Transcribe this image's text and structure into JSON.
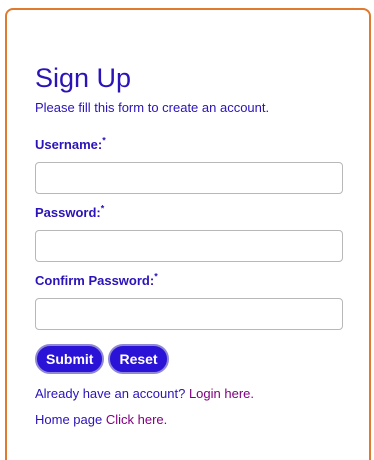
{
  "form": {
    "title": "Sign Up",
    "subtitle": "Please fill this form to create an account.",
    "required_marker": "*",
    "fields": [
      {
        "label": "Username:",
        "value": "",
        "placeholder": ""
      },
      {
        "label": "Password:",
        "value": "",
        "placeholder": ""
      },
      {
        "label": "Confirm Password:",
        "value": "",
        "placeholder": ""
      }
    ],
    "submit_label": "Submit",
    "reset_label": "Reset",
    "login_prompt": "Already have an account?",
    "login_link": "Login here.",
    "home_prompt": "Home page",
    "home_link": "Click here."
  },
  "colors": {
    "accent_border": "#e07a2e",
    "text": "#2a13b8",
    "button_bg": "#2a13d6",
    "link": "#800080"
  }
}
